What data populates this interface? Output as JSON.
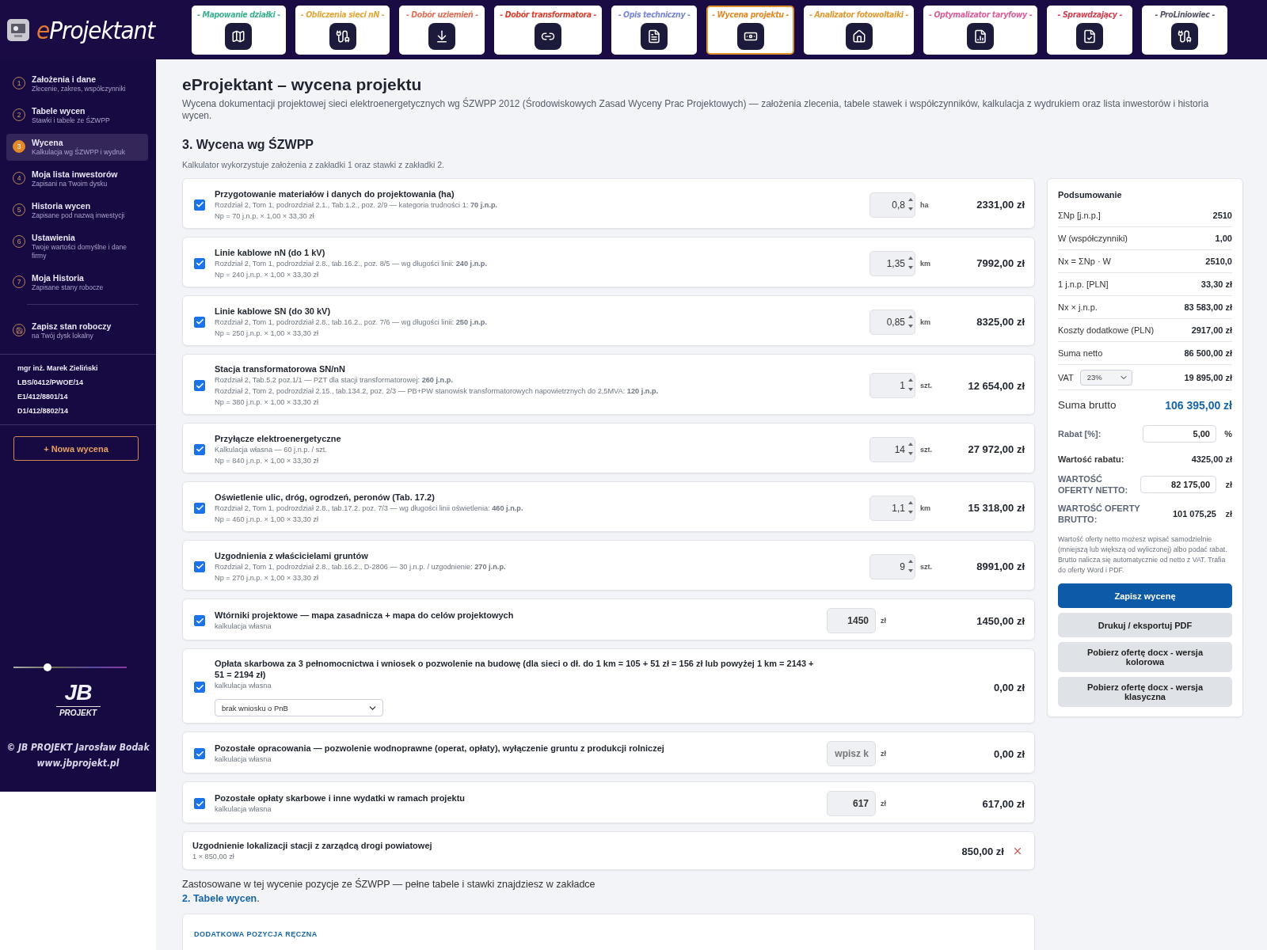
{
  "app": {
    "title": "eProjektant"
  },
  "modules": [
    {
      "label": "- Mapowanie działki -",
      "color": "#3bb08f",
      "selected": false
    },
    {
      "label": "- Obliczenia sieci nN -",
      "color": "#e0a83a",
      "selected": false
    },
    {
      "label": "- Dobór uziemień -",
      "color": "#e07058",
      "selected": false
    },
    {
      "label": "- Dobór transformatora -",
      "color": "#d8402e",
      "selected": false
    },
    {
      "label": "- Opis techniczny -",
      "color": "#7a86d6",
      "selected": false
    },
    {
      "label": "- Wycena projektu -",
      "color": "#e08a2a",
      "selected": true
    },
    {
      "label": "- Analizator fotowoltaiki -",
      "color": "#e09a30",
      "selected": false
    },
    {
      "label": "- Optymalizator taryfowy -",
      "color": "#d8609a",
      "selected": false
    },
    {
      "label": "- Sprawdzający -",
      "color": "#d04050",
      "selected": false
    },
    {
      "label": "- ProLiniowiec -",
      "color": "#555566",
      "selected": false
    }
  ],
  "sidebar": {
    "items": [
      {
        "number": "1",
        "title": "Założenia i dane",
        "subtitle": "Zlecenie, zakres, współczynniki",
        "selected": false
      },
      {
        "number": "2",
        "title": "Tabele wycen",
        "subtitle": "Stawki i tabele ze ŚZWPP",
        "selected": false
      },
      {
        "number": "3",
        "title": "Wycena",
        "subtitle": "Kalkulacja wg ŚZWPP i wydruk",
        "selected": true
      },
      {
        "number": "4",
        "title": "Moja lista inwestorów",
        "subtitle": "Zapisani na Twoim dysku",
        "selected": false
      },
      {
        "number": "5",
        "title": "Historia wycen",
        "subtitle": "Zapisane pod nazwą inwestycji",
        "selected": false
      },
      {
        "number": "6",
        "title": "Ustawienia",
        "subtitle": "Twoje wartości domyślne i dane firmy",
        "selected": false
      },
      {
        "number": "7",
        "title": "Moja Historia",
        "subtitle": "Zapisane stany robocze",
        "selected": false
      }
    ],
    "save": {
      "title": "Zapisz stan roboczy",
      "subtitle": "na Twój dysk lokalny"
    },
    "credentials": [
      "mgr inż. Marek Zieliński",
      "LBS/0412/PWOE/14",
      "E1/412/8801/14",
      "D1/412/8802/14"
    ],
    "new_button": "+ Nowa wycena",
    "theme_slider": {
      "level": 0.3
    },
    "logo": {
      "mark": "JB",
      "text": "PROJEKT"
    },
    "footer": [
      "© JB PROJEKT Jarosław Bodak",
      "www.jbprojekt.pl"
    ]
  },
  "page": {
    "title": "eProjektant – wycena projektu",
    "description": "Wycena dokumentacji projektowej sieci elektroenergetycznych wg ŚZWPP 2012 (Środowiskowych Zasad Wyceny Prac Projektowych) — założenia zlecenia, tabele stawek i współczynników, kalkulacja z wydrukiem oraz lista inwestorów i historia wycen.",
    "section": "3. Wycena wg ŚZWPP",
    "hint": "Kalkulator wykorzystuje założenia z zakładki 1 oraz stawki z zakładki 2."
  },
  "items": [
    {
      "title": "Przygotowanie materiałów i danych do projektowania (ha)",
      "lines": [
        "Rozdział 2, Tom 1, podrozdział 2.1., Tab.1.2., poz. 2/9 — kategoria trudności 1: **70 j.n.p.**",
        "Np = 70 j.n.p. × 1,00 × 33,30 zł"
      ],
      "checked": true,
      "qty": {
        "kind": "spinner",
        "value": "0,8",
        "unit": "ha"
      },
      "total": "2331,00 zł"
    },
    {
      "title": "Linie kablowe nN (do 1 kV)",
      "lines": [
        "Rozdział 2, Tom 1, podrozdział 2.8., tab.16.2., poz. 8/5 — wg długości linii: **240 j.n.p.**",
        "Np = 240 j.n.p. × 1,00 × 33,30 zł"
      ],
      "checked": true,
      "qty": {
        "kind": "spinner",
        "value": "1,35",
        "unit": "km"
      },
      "total": "7992,00 zł"
    },
    {
      "title": "Linie kablowe SN (do 30 kV)",
      "lines": [
        "Rozdział 2, Tom 1, podrozdział 2.8., tab.16.2., poz. 7/6 — wg długości linii: **250 j.n.p.**",
        "Np = 250 j.n.p. × 1,00 × 33,30 zł"
      ],
      "checked": true,
      "qty": {
        "kind": "spinner",
        "value": "0,85",
        "unit": "km"
      },
      "total": "8325,00 zł"
    },
    {
      "title": "Stacja transformatorowa SN/nN",
      "lines": [
        "Rozdział 2, Tab.5.2 poz.1/1 — PZT dla stacji transformatorowej: **260 j.n.p.**",
        "Rozdział 2, Tom 2, podrozdział 2.15., tab.134.2, poz. 2/3 — PB+PW stanowisk transformatorowych napowietrznych do 2,5MVA: **120 j.n.p.**",
        "Np = 380 j.n.p. × 1,00 × 33,30 zł"
      ],
      "checked": true,
      "qty": {
        "kind": "spinner",
        "value": "1",
        "unit": "szt."
      },
      "total": "12 654,00 zł"
    },
    {
      "title": "Przyłącze elektroenergetyczne",
      "lines": [
        "Kalkulacja własna — 60 j.n.p. / szt.",
        "Np = 840 j.n.p. × 1,00 × 33,30 zł"
      ],
      "checked": true,
      "qty": {
        "kind": "spinner",
        "value": "14",
        "unit": "szt."
      },
      "total": "27 972,00 zł"
    },
    {
      "title": "Oświetlenie ulic, dróg, ogrodzeń, peronów (Tab. 17.2)",
      "lines": [
        "Rozdział 2, Tom 1, podrozdział 2.8., tab.17.2. poz. 7/3 — wg długości linii oświetlenia: **460 j.n.p.**",
        "Np = 460 j.n.p. × 1,00 × 33,30 zł"
      ],
      "checked": true,
      "qty": {
        "kind": "spinner",
        "value": "1,1",
        "unit": "km"
      },
      "total": "15 318,00 zł"
    },
    {
      "title": "Uzgodnienia z właścicielami gruntów",
      "lines": [
        "Rozdział 2, Tom 1, podrozdział 2.8., tab.16.2., D-2806 — 30 j.n.p. / uzgodnienie: **270 j.n.p.**",
        "Np = 270 j.n.p. × 1,00 × 33,30 zł"
      ],
      "checked": true,
      "qty": {
        "kind": "spinner",
        "value": "9",
        "unit": "szt."
      },
      "total": "8991,00 zł"
    },
    {
      "title": "Wtórniki projektowe — mapa zasadnicza + mapa do celów projektowych",
      "lines": [
        "kalkulacja własna"
      ],
      "checked": true,
      "qty": {
        "kind": "amount",
        "value": "1450",
        "unit": "zł"
      },
      "total": "1450,00 zł"
    },
    {
      "title": "Opłata skarbowa za 3 pełnomocnictwa i wniosek o pozwolenie na budowę (dla sieci o dł. do 1 km = 105 + 51 zł = 156 zł lub powyżej 1 km = 2143 + 51 = 2194 zł)",
      "lines": [
        "kalkulacja własna"
      ],
      "checked": true,
      "select": "brak wniosku o PnB",
      "total": "0,00 zł"
    },
    {
      "title": "Pozostałe opracowania — pozwolenie wodnoprawne (operat, opłaty), wyłączenie gruntu z produkcji rolniczej",
      "lines": [
        "kalkulacja własna"
      ],
      "checked": true,
      "qty": {
        "kind": "amount",
        "placeholder": "wpisz k",
        "unit": "zł"
      },
      "total": "0,00 zł"
    },
    {
      "title": "Pozostałe opłaty skarbowe i inne wydatki w ramach projektu",
      "lines": [
        "kalkulacja własna"
      ],
      "checked": true,
      "qty": {
        "kind": "amount",
        "value": "617",
        "unit": "zł"
      },
      "total": "617,00 zł"
    }
  ],
  "manual_items": [
    {
      "title": "Uzgodnienie lokalizacji stacji z zarządcą drogi powiatowej",
      "detail": "1 × 850,00 zł",
      "total": "850,00 zł"
    }
  ],
  "footer_note": {
    "text": "Zastosowane w tej wycenie pozycje ze ŚZWPP — pełne tabele i stawki znajdziesz w zakładce",
    "link": "2. Tabele wycen",
    "after": "."
  },
  "manual_form": {
    "title": "DODATKOWA POZYCJA RĘCZNA"
  },
  "summary": {
    "title": "Podsumowanie",
    "rows": [
      {
        "kind": "line",
        "label": "ΣNp [j.n.p.]",
        "value": "2510"
      },
      {
        "kind": "line",
        "label": "W (współczynniki)",
        "value": "1,00"
      },
      {
        "kind": "line",
        "label": "Nx = ΣNp · W",
        "value": "2510,0"
      },
      {
        "kind": "line",
        "label": "1 j.n.p. [PLN]",
        "value": "33,30 zł"
      },
      {
        "kind": "line",
        "label": "Nx × j.n.p.",
        "value": "83 583,00 zł"
      },
      {
        "kind": "line",
        "label": "Koszty dodatkowe (PLN)",
        "value": "2917,00 zł"
      },
      {
        "kind": "line",
        "label": "Suma netto",
        "value": "86 500,00 zł"
      },
      {
        "kind": "select",
        "label": "VAT",
        "option": "23%",
        "value": "19 895,00 zł"
      },
      {
        "kind": "total",
        "label": "Suma brutto",
        "value": "106 395,00 zł"
      },
      {
        "kind": "field",
        "label": "Rabat [%]:",
        "value": "5,00",
        "unit": "%"
      },
      {
        "kind": "strong",
        "label": "Wartość rabatu:",
        "value": "4325,00 zł"
      },
      {
        "kind": "field",
        "label": "WARTOŚĆ OFERTY NETTO:",
        "value": "82 175,00",
        "unit": "zł"
      },
      {
        "kind": "value",
        "label": "WARTOŚĆ OFERTY BRUTTO:",
        "value": "101 075,25",
        "unit": "zł"
      }
    ],
    "note": "Wartość oferty netto możesz wpisać samodzielnie (mniejszą lub większą od wyliczonej) albo podać rabat. Brutto nalicza się automatycznie od netto z VAT. Trafia do oferty Word i PDF.",
    "buttons": [
      {
        "label": "Zapisz wycenę",
        "kind": "primary"
      },
      {
        "label": "Drukuj / eksportuj PDF",
        "kind": "secondary"
      },
      {
        "label": "Pobierz ofertę docx - wersja kolorowa",
        "kind": "secondary"
      },
      {
        "label": "Pobierz ofertę docx - wersja klasyczna",
        "kind": "secondary"
      }
    ]
  }
}
